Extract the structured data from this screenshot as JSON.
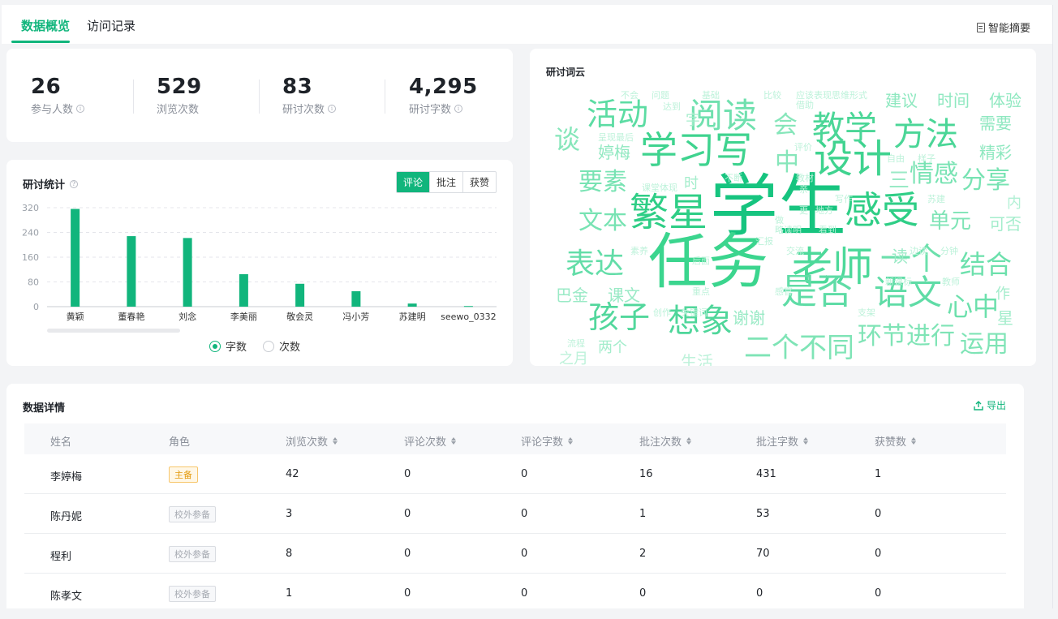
{
  "tabs": [
    {
      "label": "数据概览",
      "active": true
    },
    {
      "label": "访问记录",
      "active": false
    }
  ],
  "summary_button": "智能摘要",
  "stats": [
    {
      "value": "26",
      "label": "参与人数",
      "info": true
    },
    {
      "value": "529",
      "label": "浏览次数",
      "info": false
    },
    {
      "value": "83",
      "label": "研讨次数",
      "info": true
    },
    {
      "value": "4,295",
      "label": "研讨字数",
      "info": true
    }
  ],
  "stats_chart": {
    "title": "研讨统计",
    "segments": [
      "评论",
      "批注",
      "获赞"
    ],
    "active_segment": "评论",
    "radio_options": [
      "字数",
      "次数"
    ],
    "active_radio": "字数"
  },
  "chart_data": {
    "type": "bar",
    "categories": [
      "黄颖",
      "董春艳",
      "刘念",
      "李美丽",
      "敬会灵",
      "冯小芳",
      "苏建明",
      "seewo_0332"
    ],
    "values": [
      316,
      228,
      222,
      105,
      74,
      50,
      10,
      2
    ],
    "ylim": [
      0,
      320
    ],
    "yticks": [
      0,
      80,
      160,
      240,
      320
    ],
    "grid": true,
    "color": "#11b57c"
  },
  "word_cloud": {
    "title": "研讨词云",
    "words": [
      {
        "t": "学生",
        "c": "#16c47f"
      },
      {
        "t": "任务",
        "c": "#3bd58e"
      },
      {
        "t": "繁星",
        "c": "#2fce86"
      },
      {
        "t": "感受",
        "c": "#2fce86"
      },
      {
        "t": "老师",
        "c": "#4dd99a"
      },
      {
        "t": "学习写",
        "c": "#3fd38f"
      },
      {
        "t": "设计",
        "c": "#3fd38f"
      },
      {
        "t": "阅读",
        "c": "#6fe0ae"
      },
      {
        "t": "教学",
        "c": "#4bd697"
      },
      {
        "t": "方法",
        "c": "#4bd697"
      },
      {
        "t": "活动",
        "c": "#5cdca3"
      },
      {
        "t": "想象",
        "c": "#4fd69a"
      },
      {
        "t": "是否",
        "c": "#5fdca6"
      },
      {
        "t": "语文",
        "c": "#5fdca6"
      },
      {
        "t": "孩子",
        "c": "#52d79c"
      },
      {
        "t": "表达",
        "c": "#63dda8"
      },
      {
        "t": "一个",
        "c": "#6ce0ac"
      },
      {
        "t": "结合",
        "c": "#6ce0ac"
      },
      {
        "t": "心中",
        "c": "#6ce0ac"
      },
      {
        "t": "文本",
        "c": "#78e3b3"
      },
      {
        "t": "要素",
        "c": "#78e3b3"
      },
      {
        "t": "情感",
        "c": "#78e3b3"
      },
      {
        "t": "分享",
        "c": "#78e3b3"
      },
      {
        "t": "单元",
        "c": "#7fe4b6"
      },
      {
        "t": "环节进行",
        "c": "#7fe4b6"
      },
      {
        "t": "运用",
        "c": "#7fe4b6"
      },
      {
        "t": "二个不同",
        "c": "#7fe4b6"
      },
      {
        "t": "谈",
        "c": "#86e6ba"
      },
      {
        "t": "会",
        "c": "#86e6ba"
      },
      {
        "t": "中",
        "c": "#86e6ba"
      },
      {
        "t": "三",
        "c": "#9aeac6"
      },
      {
        "t": "建议",
        "c": "#8fe8c0"
      },
      {
        "t": "时间",
        "c": "#8fe8c0"
      },
      {
        "t": "体验",
        "c": "#8fe8c0"
      },
      {
        "t": "需要",
        "c": "#8fe8c0"
      },
      {
        "t": "精彩",
        "c": "#8fe8c0"
      },
      {
        "t": "婷梅",
        "c": "#8fe8c0"
      },
      {
        "t": "巴金",
        "c": "#9aeac6"
      },
      {
        "t": "课文",
        "c": "#9aeac6"
      },
      {
        "t": "谢谢",
        "c": "#9aeac6"
      },
      {
        "t": "读",
        "c": "#9aeac6"
      },
      {
        "t": "可否",
        "c": "#a4edcc"
      },
      {
        "t": "作",
        "c": "#a4edcc"
      },
      {
        "t": "星",
        "c": "#a4edcc"
      },
      {
        "t": "两个",
        "c": "#a4edcc"
      },
      {
        "t": "时",
        "c": "#a4edcc"
      },
      {
        "t": "字",
        "c": "#a4edcc"
      },
      {
        "t": "内",
        "c": "#b2f0d5"
      },
      {
        "t": "不会",
        "c": "#bdf2da"
      },
      {
        "t": "问题",
        "c": "#bdf2da"
      },
      {
        "t": "达到",
        "c": "#bdf2da"
      },
      {
        "t": "基础",
        "c": "#bdf2da"
      },
      {
        "t": "比较",
        "c": "#bdf2da"
      },
      {
        "t": "应该表现思维形式",
        "c": "#bdf2da"
      },
      {
        "t": "借助",
        "c": "#bdf2da"
      },
      {
        "t": "呈现最后",
        "c": "#bdf2da"
      },
      {
        "t": "评价",
        "c": "#bdf2da"
      },
      {
        "t": "自由",
        "c": "#bdf2da"
      },
      {
        "t": "样子",
        "c": "#bdf2da"
      },
      {
        "t": "不断",
        "c": "#bdf2da"
      },
      {
        "t": "教材",
        "c": "#bdf2da"
      },
      {
        "t": "课堂体现",
        "c": "#bdf2da"
      },
      {
        "t": "亲",
        "c": "#bdf2da"
      },
      {
        "t": "写作",
        "c": "#bdf2da"
      },
      {
        "t": "苏建",
        "c": "#bdf2da"
      },
      {
        "t": "更",
        "c": "#bdf2da"
      },
      {
        "t": "地方",
        "c": "#bdf2da"
      },
      {
        "t": "做",
        "c": "#bdf2da"
      },
      {
        "t": "略读明",
        "c": "#bdf2da"
      },
      {
        "t": "看到",
        "c": "#bdf2da"
      },
      {
        "t": "汇报",
        "c": "#bdf2da"
      },
      {
        "t": "素养",
        "c": "#bdf2da"
      },
      {
        "t": "交流",
        "c": "#bdf2da"
      },
      {
        "t": "边读",
        "c": "#bdf2da"
      },
      {
        "t": "分钟",
        "c": "#bdf2da"
      },
      {
        "t": "后面",
        "c": "#bdf2da"
      },
      {
        "t": "新课标",
        "c": "#bdf2da"
      },
      {
        "t": "教师",
        "c": "#bdf2da"
      },
      {
        "t": "重点",
        "c": "#bdf2da"
      },
      {
        "t": "感官",
        "c": "#bdf2da"
      },
      {
        "t": "创作",
        "c": "#bdf2da"
      },
      {
        "t": "关键词",
        "c": "#bdf2da"
      },
      {
        "t": "支架",
        "c": "#bdf2da"
      },
      {
        "t": "流程",
        "c": "#bdf2da"
      },
      {
        "t": "之月",
        "c": "#bdf2da"
      },
      {
        "t": "生活",
        "c": "#bdf2da"
      }
    ]
  },
  "details": {
    "title": "数据详情",
    "export_label": "导出",
    "columns": [
      {
        "label": "姓名",
        "sortable": false
      },
      {
        "label": "角色",
        "sortable": false
      },
      {
        "label": "浏览次数",
        "sortable": true
      },
      {
        "label": "评论次数",
        "sortable": true
      },
      {
        "label": "评论字数",
        "sortable": true
      },
      {
        "label": "批注次数",
        "sortable": true
      },
      {
        "label": "批注字数",
        "sortable": true
      },
      {
        "label": "获赞数",
        "sortable": true
      }
    ],
    "rows": [
      {
        "name": "李婷梅",
        "role": "主备",
        "role_main": true,
        "views": "42",
        "comments": "0",
        "comment_words": "0",
        "annotations": "16",
        "annotation_words": "431",
        "likes": "1"
      },
      {
        "name": "陈丹妮",
        "role": "校外参备",
        "role_main": false,
        "views": "3",
        "comments": "0",
        "comment_words": "0",
        "annotations": "1",
        "annotation_words": "53",
        "likes": "0"
      },
      {
        "name": "程利",
        "role": "校外参备",
        "role_main": false,
        "views": "8",
        "comments": "0",
        "comment_words": "0",
        "annotations": "2",
        "annotation_words": "70",
        "likes": "0"
      },
      {
        "name": "陈孝文",
        "role": "校外参备",
        "role_main": false,
        "views": "1",
        "comments": "0",
        "comment_words": "0",
        "annotations": "0",
        "annotation_words": "0",
        "likes": "0"
      }
    ]
  }
}
